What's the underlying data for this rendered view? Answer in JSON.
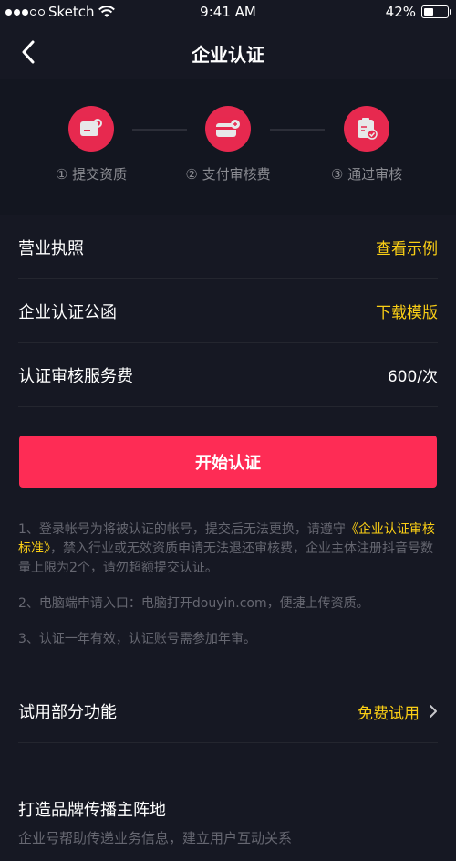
{
  "status_bar": {
    "carrier": "Sketch",
    "time": "9:41 AM",
    "battery": "42%",
    "battery_level": 0.42
  },
  "nav": {
    "title": "企业认证",
    "back_icon": "chevron-left-icon"
  },
  "steps": [
    {
      "label": "① 提交资质",
      "icon": "document-icon"
    },
    {
      "label": "② 支付审核费",
      "icon": "card-icon"
    },
    {
      "label": "③ 通过审核",
      "icon": "approved-icon"
    }
  ],
  "rows": [
    {
      "label": "营业执照",
      "action": "查看示例"
    },
    {
      "label": "企业认证公函",
      "action": "下载模版"
    },
    {
      "label": "认证审核服务费",
      "value": "600/次"
    }
  ],
  "start_button": "开始认证",
  "notes": {
    "note1_prefix": "1、登录帐号为将被认证的帐号，提交后无法更换，请遵守",
    "note1_link": "《企业认证审核标准》",
    "note1_suffix": "，禁入行业或无效资质申请无法退还审核费，企业主体注册抖音号数量上限为2个，请勿超额提交认证。",
    "note2": "2、电脑端申请入口：电脑打开douyin.com，便捷上传资质。",
    "note3": "3、认证一年有效，认证账号需参加年审。"
  },
  "trial": {
    "label": "试用部分功能",
    "action": "免费试用"
  },
  "brand": {
    "title": "打造品牌传播主阵地",
    "desc": "企业号帮助传递业务信息，建立用户互动关系"
  },
  "colors": {
    "background": "#161823",
    "accent": "#fe2c55",
    "link": "#face15"
  }
}
